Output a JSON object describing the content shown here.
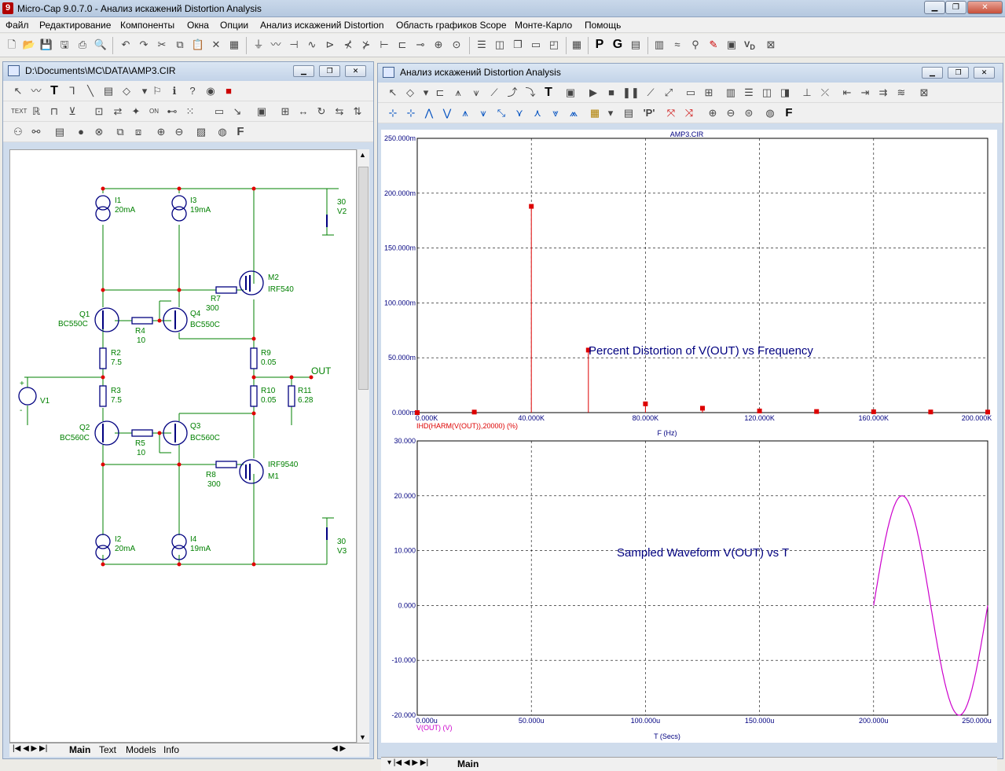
{
  "app": {
    "title": "Micro-Cap 9.0.7.0 - Анализ искажений Distortion Analysis",
    "logo": "9"
  },
  "menu": [
    "Файл",
    "Редактирование",
    "Компоненты",
    "Окна",
    "Опции",
    "Анализ искажений Distortion",
    "Область графиков Scope",
    "Монте-Карло",
    "Помощь"
  ],
  "schematic": {
    "title": "D:\\Documents\\MC\\DATA\\AMP3.CIR",
    "tabs": [
      "Main",
      "Text",
      "Models",
      "Info"
    ],
    "labels": {
      "I1": "I1",
      "I1v": "20mA",
      "I3": "I3",
      "I3v": "19mA",
      "V2": "V2",
      "V2v": "30",
      "M2": "M2",
      "M2m": "IRF540",
      "R7": "R7",
      "R7v": "300",
      "Q1": "Q1",
      "Q1m": "BC550C",
      "R4": "R4",
      "R4v": "10",
      "Q4": "Q4",
      "Q4m": "BC550C",
      "R2": "R2",
      "R2v": "7.5",
      "R9": "R9",
      "R9v": "0.05",
      "OUT": "OUT",
      "V1": "V1",
      "R3": "R3",
      "R3v": "7.5",
      "R10": "R10",
      "R10v": "0.05",
      "R11": "R11",
      "R11v": "6.28",
      "Q2": "Q2",
      "Q2m": "BC560C",
      "R5": "R5",
      "R5v": "10",
      "Q3": "Q3",
      "Q3m": "BC560C",
      "M1": "M1",
      "M1m": "IRF9540",
      "R8": "R8",
      "R8v": "300",
      "I2": "I2",
      "I2v": "20mA",
      "I4": "I4",
      "I4v": "19mA",
      "V3": "V3",
      "V3v": "30",
      "plus": "+",
      "minus": "-"
    }
  },
  "analysis": {
    "title": "Анализ искажений Distortion Analysis",
    "tab": "Main",
    "top_plot": {
      "title": "AMP3.CIR",
      "annotation": "Percent Distortion of V(OUT) vs Frequency",
      "ytick_labels": [
        "250.000m",
        "200.000m",
        "150.000m",
        "100.000m",
        "50.000m",
        "0.000m"
      ],
      "xtick_labels": [
        "0.000K",
        "40.000K",
        "80.000K",
        "120.000K",
        "160.000K",
        "200.000K"
      ],
      "trace_label": "IHD(HARM(V(OUT)),20000) (%)",
      "xlabel": "F (Hz)",
      "color": "#dd0000"
    },
    "bottom_plot": {
      "annotation": "Sampled Waveform  V(OUT) vs T",
      "ytick_labels": [
        "30.000",
        "20.000",
        "10.000",
        "0.000",
        "-10.000",
        "-20.000"
      ],
      "xtick_labels": [
        "0.000u",
        "50.000u",
        "100.000u",
        "150.000u",
        "200.000u",
        "250.000u"
      ],
      "trace_label": "V(OUT) (V)",
      "xlabel": "T (Secs)",
      "color": "#cc00cc"
    }
  },
  "chart_data": [
    {
      "type": "bar",
      "title": "AMP3.CIR",
      "xlabel": "F (Hz)",
      "ylabel": "IHD(HARM(V(OUT)),20000) (%)",
      "xlim": [
        0,
        200000
      ],
      "ylim": [
        0,
        0.25
      ],
      "grid": true,
      "x": [
        0,
        20000,
        40000,
        60000,
        80000,
        100000,
        120000,
        140000,
        160000,
        180000,
        200000
      ],
      "values": [
        0.0,
        0.0005,
        0.188,
        0.057,
        0.008,
        0.004,
        0.0015,
        0.001,
        0.0008,
        0.0006,
        0.0005
      ]
    },
    {
      "type": "line",
      "xlabel": "T (Secs)",
      "ylabel": "V(OUT) (V)",
      "xlim": [
        0,
        0.00025
      ],
      "ylim": [
        -20,
        30
      ],
      "grid": true,
      "series": [
        {
          "name": "V(OUT) (V)",
          "x_start": 0.0002,
          "x_end": 0.00025,
          "amplitude": 20,
          "period": 5e-05
        }
      ]
    }
  ]
}
